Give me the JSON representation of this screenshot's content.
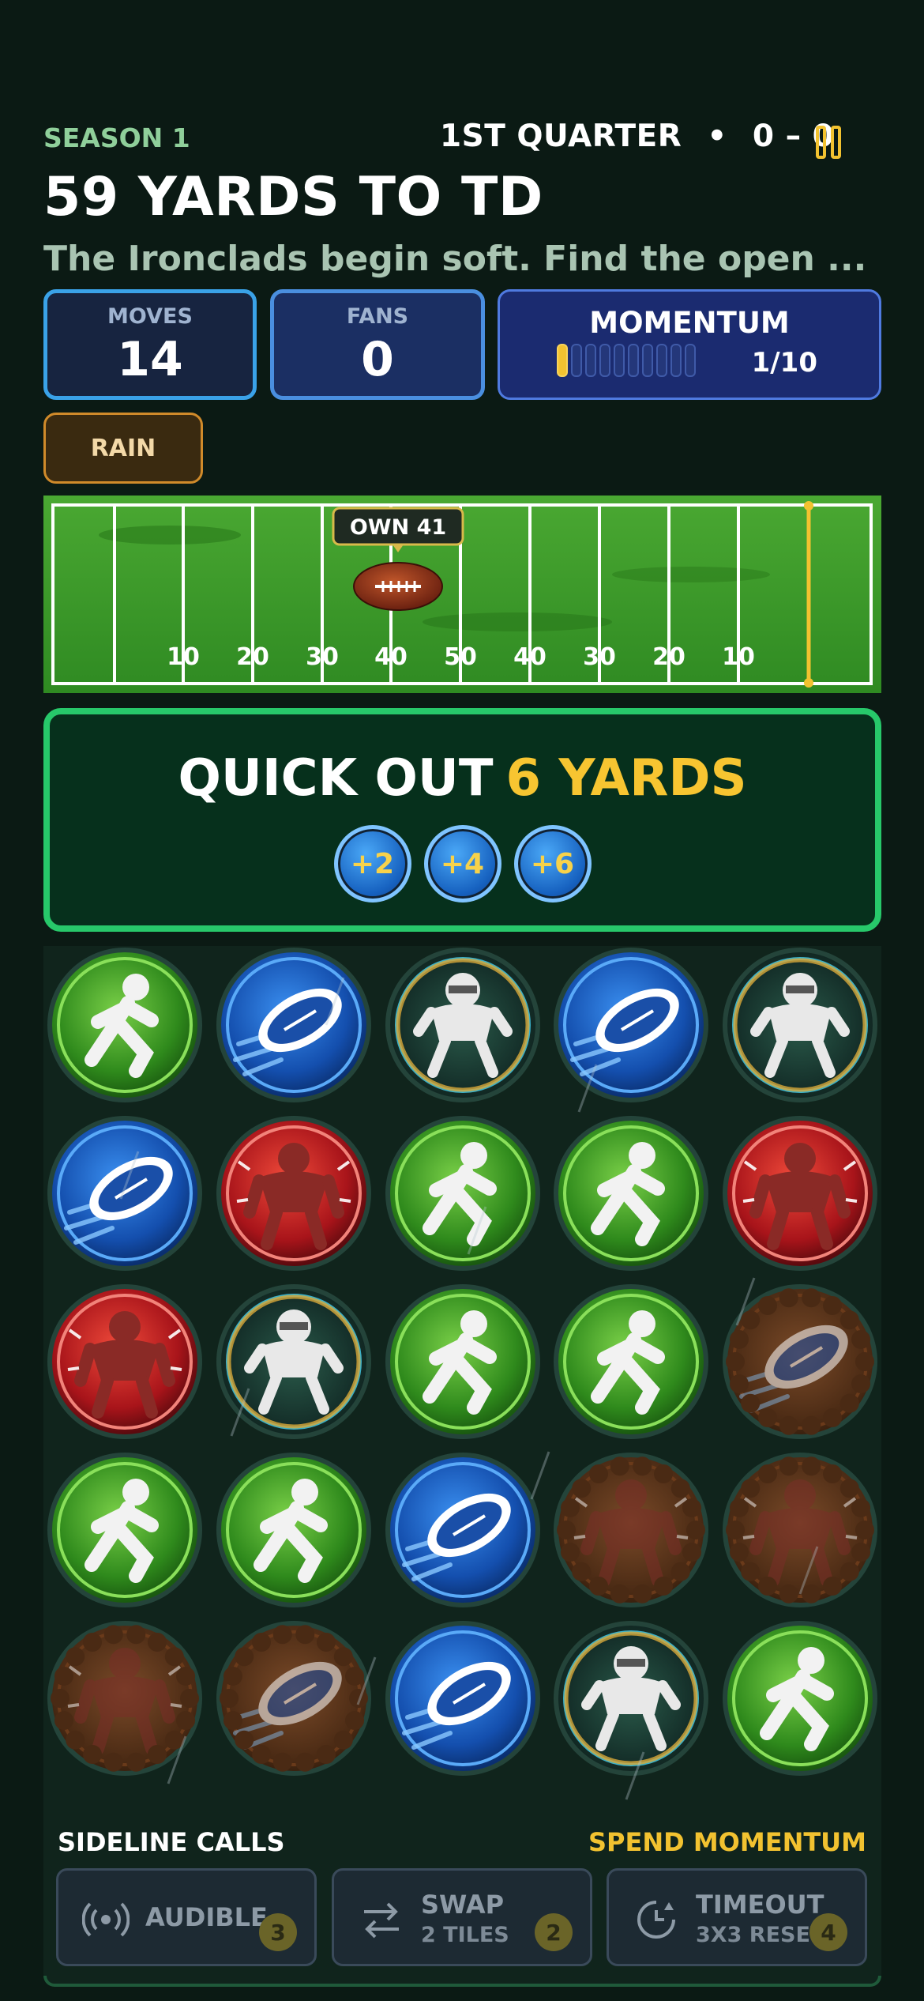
{
  "header": {
    "season": "SEASON 1",
    "quarter": "1ST QUARTER",
    "separator": "•",
    "score": "0 – 0",
    "pause_icon": "pause-icon"
  },
  "objective": {
    "title": "59 YARDS TO TD",
    "subtitle": "The Ironclads begin soft. Find the open ..."
  },
  "stats": {
    "moves_label": "MOVES",
    "moves_value": "14",
    "fans_label": "FANS",
    "fans_value": "0",
    "momentum_label": "MOMENTUM",
    "momentum_value": 1,
    "momentum_max": 10,
    "momentum_text": "1/10"
  },
  "weather": {
    "label": "RAIN"
  },
  "field": {
    "ball_position_label": "OWN 41",
    "yard_labels": [
      "10",
      "20",
      "30",
      "40",
      "50",
      "40",
      "30",
      "20",
      "10"
    ],
    "colors": {
      "turf": "#3f9a2a",
      "lines": "#ffffff",
      "goalpost": "#f2c230"
    }
  },
  "play": {
    "name": "QUICK OUT",
    "yards": "6 YARDS",
    "chips": [
      "+2",
      "+4",
      "+6"
    ]
  },
  "board": {
    "rows": [
      [
        "runner",
        "football",
        "lineman",
        "football",
        "lineman"
      ],
      [
        "football",
        "blitzer",
        "runner",
        "runner",
        "blitzer"
      ],
      [
        "blitzer",
        "lineman",
        "runner",
        "runner",
        "mud-football"
      ],
      [
        "runner",
        "runner",
        "football",
        "mud-blitzer",
        "mud-blitzer"
      ],
      [
        "mud-blitzer",
        "mud-football",
        "football",
        "lineman",
        "runner"
      ]
    ],
    "tile_colors": {
      "runner": "#3a9a22",
      "football": "#1a5fc8",
      "lineman": "#1a3b3a",
      "blitzer": "#b81818",
      "mud": "#5a3118"
    }
  },
  "sideline": {
    "title": "SIDELINE CALLS",
    "hint": "SPEND MOMENTUM",
    "calls": [
      {
        "name": "AUDIBLE",
        "sub": "",
        "cost": "3",
        "icon": "broadcast-icon"
      },
      {
        "name": "SWAP",
        "sub": "2 TILES",
        "cost": "2",
        "icon": "swap-arrows-icon"
      },
      {
        "name": "TIMEOUT",
        "sub": "3X3 RESET",
        "cost": "4",
        "icon": "timer-icon"
      }
    ]
  }
}
